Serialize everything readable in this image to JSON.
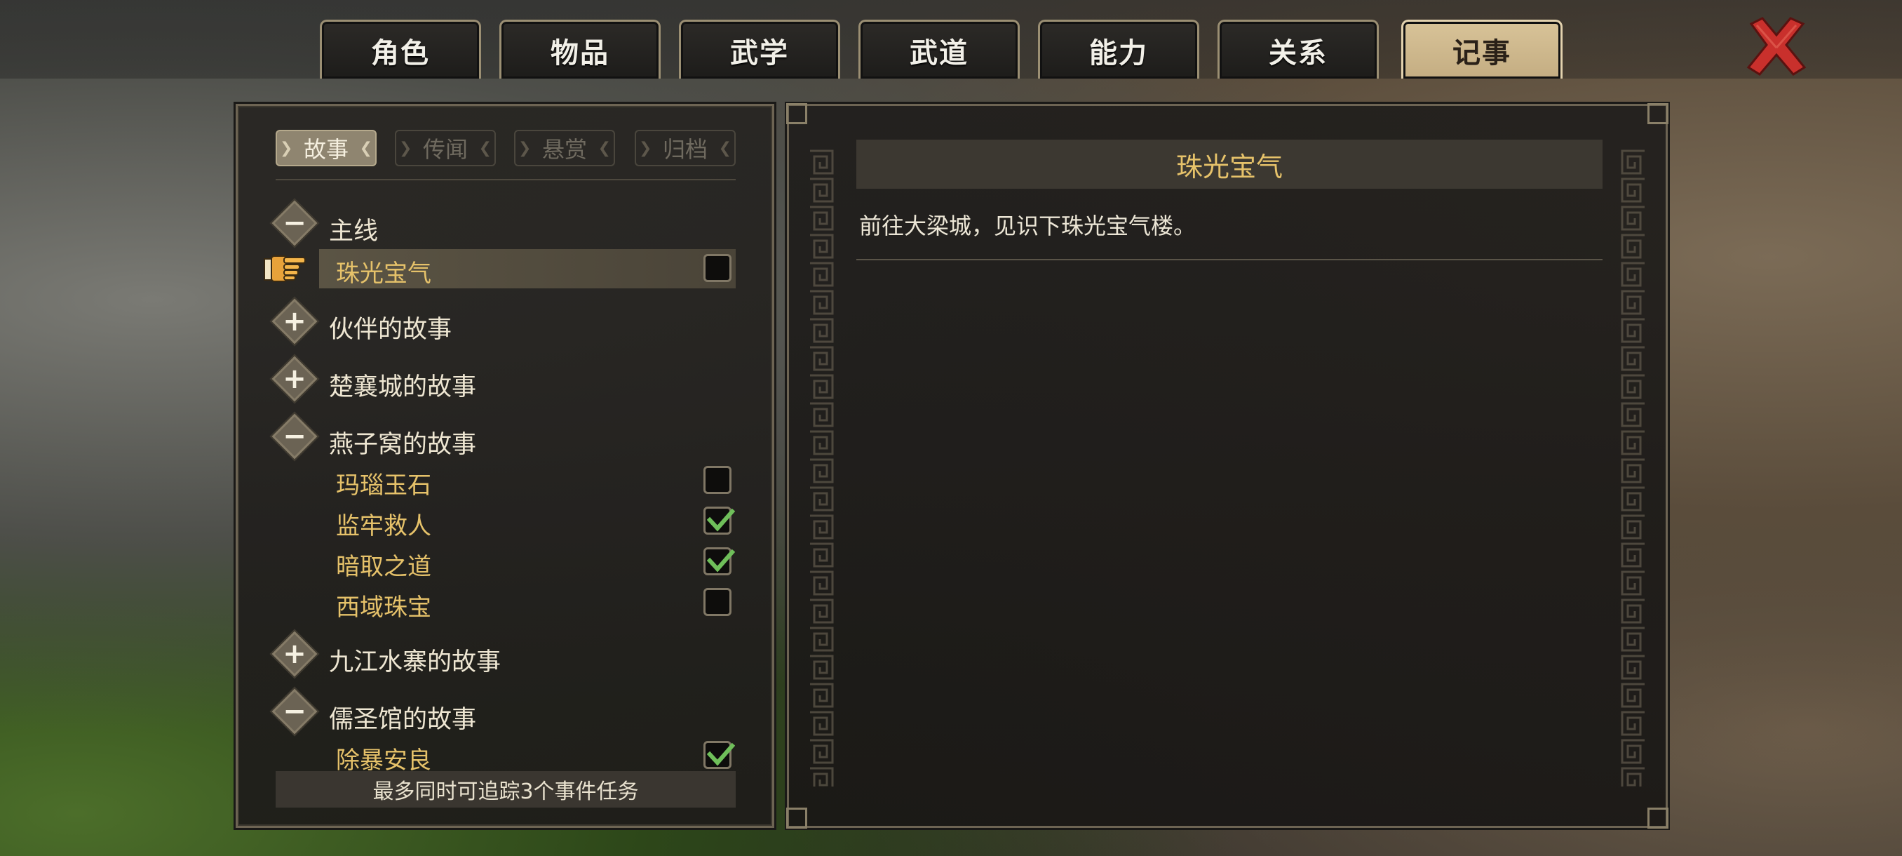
{
  "tabs": [
    {
      "label": "角色"
    },
    {
      "label": "物品"
    },
    {
      "label": "武学"
    },
    {
      "label": "武道"
    },
    {
      "label": "能力"
    },
    {
      "label": "关系"
    },
    {
      "label": "记事"
    }
  ],
  "active_tab": "记事",
  "subtabs": [
    {
      "label": "故事"
    },
    {
      "label": "传闻"
    },
    {
      "label": "悬赏"
    },
    {
      "label": "归档"
    }
  ],
  "active_subtab": "故事",
  "quest_tree": {
    "main": {
      "label": "主线",
      "expanded": true
    },
    "main_items": [
      {
        "label": "珠光宝气",
        "checked": false,
        "selected": true
      }
    ],
    "companions": {
      "label": "伙伴的故事",
      "expanded": false
    },
    "chuxiang": {
      "label": "楚襄城的故事",
      "expanded": false
    },
    "yanziwo": {
      "label": "燕子窝的故事",
      "expanded": true
    },
    "yanziwo_items": [
      {
        "label": "玛瑙玉石",
        "checked": false
      },
      {
        "label": "监牢救人",
        "checked": true
      },
      {
        "label": "暗取之道",
        "checked": true
      },
      {
        "label": "西域珠宝",
        "checked": false
      }
    ],
    "jiujiang": {
      "label": "九江水寨的故事",
      "expanded": false
    },
    "rushengguan": {
      "label": "儒圣馆的故事",
      "expanded": true
    },
    "rushengguan_items": [
      {
        "label": "除暴安良",
        "checked": true
      }
    ]
  },
  "footer_note": "最多同时可追踪3个事件任务",
  "detail": {
    "title": "珠光宝气",
    "description": "前往大梁城，见识下珠光宝气楼。"
  },
  "icons": {
    "close": "close-x-icon",
    "pointer": "pointing-hand-icon",
    "expand": "plus-icon",
    "collapse": "minus-icon",
    "check": "checkmark-icon"
  },
  "colors": {
    "accent_gold": "#e6c26a",
    "active_tab": "#d2bd93",
    "close_red": "#c9302c",
    "check_green": "#6fbf5a"
  }
}
